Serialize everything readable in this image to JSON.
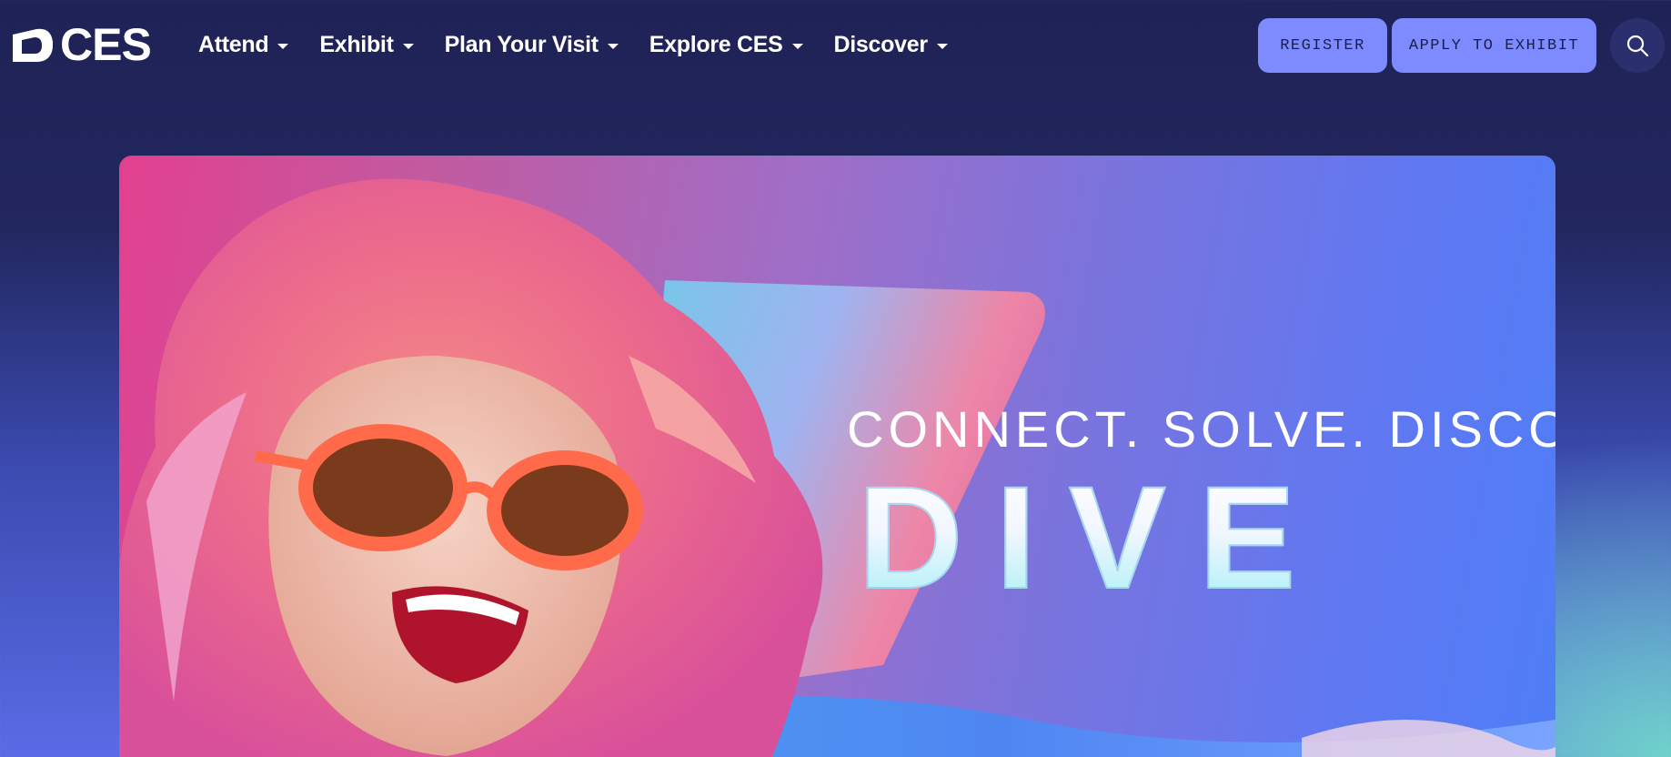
{
  "brand": {
    "name": "CES"
  },
  "nav": {
    "items": [
      {
        "label": "Attend"
      },
      {
        "label": "Exhibit"
      },
      {
        "label": "Plan Your Visit"
      },
      {
        "label": "Explore CES"
      },
      {
        "label": "Discover"
      }
    ]
  },
  "actions": {
    "register_label": "REGISTER",
    "apply_label": "APPLY TO EXHIBIT",
    "search_icon": "search-icon"
  },
  "hero": {
    "tagline": "CONNECT. SOLVE. DISCOV",
    "headline": "DIVE"
  },
  "colors": {
    "header_bg": "#1f2256",
    "button_bg": "#7d8bff",
    "button_text": "#1b1e4b",
    "search_bg": "#2a2f6e"
  }
}
